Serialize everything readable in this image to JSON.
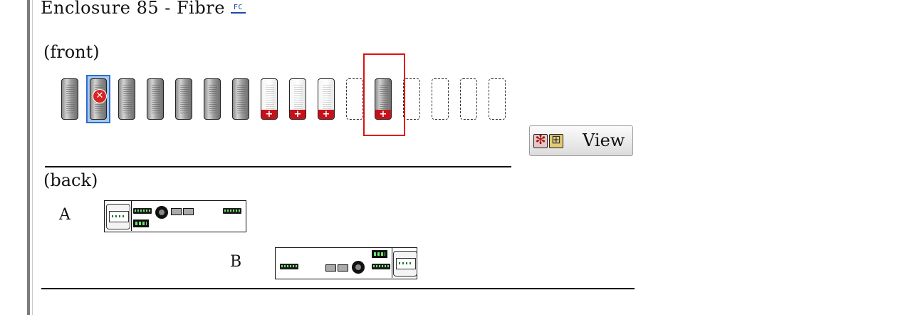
{
  "header": {
    "title": "Enclosure 85 - Fibre",
    "badge": "FC"
  },
  "front": {
    "label": "(front)",
    "slots": [
      {
        "state": "installed"
      },
      {
        "state": "failed",
        "selected": true
      },
      {
        "state": "installed"
      },
      {
        "state": "installed"
      },
      {
        "state": "installed"
      },
      {
        "state": "installed"
      },
      {
        "state": "installed"
      },
      {
        "state": "spare"
      },
      {
        "state": "spare"
      },
      {
        "state": "spare"
      },
      {
        "state": "empty"
      },
      {
        "state": "installed-spare",
        "highlighted": true
      },
      {
        "state": "empty"
      },
      {
        "state": "empty"
      },
      {
        "state": "empty"
      },
      {
        "state": "empty"
      }
    ]
  },
  "view_button": {
    "label": "View",
    "icons": [
      "fan-icon",
      "battery-icon"
    ]
  },
  "back": {
    "label": "(back)",
    "modules": [
      {
        "label": "A"
      },
      {
        "label": "B"
      }
    ]
  },
  "colors": {
    "selection": "#2c6fc9",
    "failed": "#d9231f",
    "spare_marker": "#c4121a",
    "highlight": "#e01010"
  }
}
